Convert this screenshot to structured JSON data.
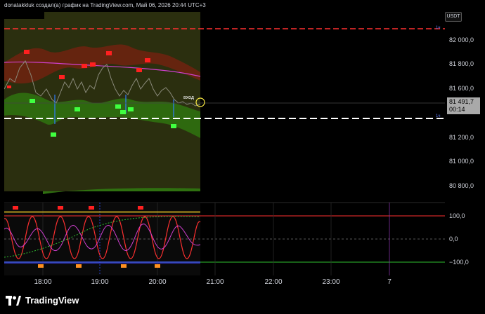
{
  "header": {
    "caption": "donatakkluk создал(а) график на TradingView.com, Май 06, 2026 20:44 UTC+3"
  },
  "price_axis": {
    "currency": "USDT",
    "labels": [
      "82 000,0",
      "81 800,0",
      "81 600,0",
      "81 200,0",
      "81 000,0",
      "80 800,0"
    ],
    "last_price": "81 491,7",
    "countdown": "00:14",
    "line_tag": "1ч"
  },
  "oscillator_axis": {
    "labels": [
      "100,0",
      "0,0",
      "−100,0"
    ]
  },
  "time_axis": {
    "labels": [
      "18:00",
      "19:00",
      "20:00",
      "21:00",
      "22:00",
      "23:00",
      "7"
    ]
  },
  "annotations": {
    "entry_label": "вход"
  },
  "footer": {
    "brand": "TradingView",
    "logo_icon": "tradingview-logo-icon"
  },
  "colors": {
    "background": "#000000",
    "session_fill": "#2b2f0f",
    "upper_band": "#8b2a12",
    "lower_band": "#3f8a14",
    "red_flag": "#ff2020",
    "green_flag": "#40ff40",
    "dashed_red": "#ff3030",
    "dashed_white": "#ffffff",
    "oscillator_red": "#ff3030",
    "oscillator_magenta": "#d040d0",
    "oscillator_green": "#30c030"
  }
}
